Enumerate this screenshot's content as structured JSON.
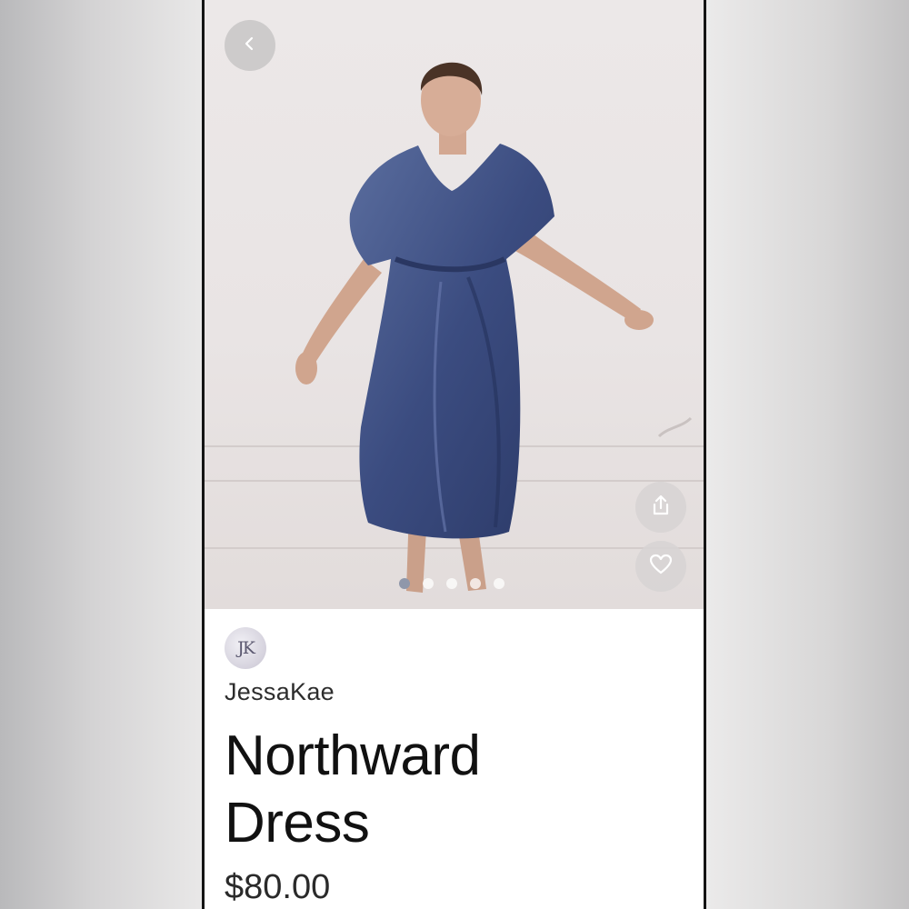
{
  "header": {
    "back_icon": "chevron-left-icon"
  },
  "product": {
    "brand_logo_text": "JK",
    "brand_name": "JessaKae",
    "title_line1": "Northward",
    "title_line2": "Dress",
    "price": "$80.00"
  },
  "actions": {
    "share_icon": "share-icon",
    "favorite_icon": "heart-icon"
  },
  "carousel": {
    "total": 5,
    "active_index": 0
  },
  "colors": {
    "dress": "#3e5186",
    "wall": "#ebe6e6",
    "text": "#111111",
    "frame": "#141414"
  }
}
